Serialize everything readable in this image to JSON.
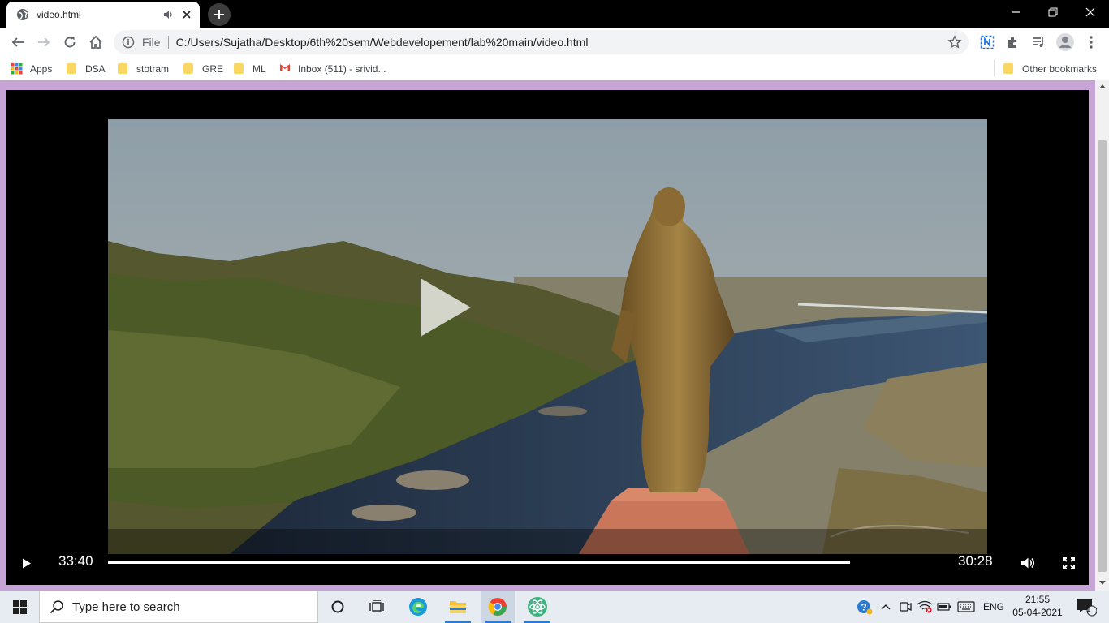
{
  "browser": {
    "tab": {
      "title": "video.html"
    },
    "address": {
      "scheme": "File",
      "url": "C:/Users/Sujatha/Desktop/6th%20sem/Webdevelopement/lab%20main/video.html"
    },
    "bookmarks": [
      {
        "label": "Apps",
        "icon": "apps-grid-icon"
      },
      {
        "label": "DSA",
        "icon": "folder-icon"
      },
      {
        "label": "stotram",
        "icon": "folder-icon"
      },
      {
        "label": "GRE",
        "icon": "folder-icon"
      },
      {
        "label": "ML",
        "icon": "folder-icon"
      },
      {
        "label": "Inbox (511) - srivid...",
        "icon": "gmail-icon"
      }
    ],
    "other_bookmarks": "Other bookmarks"
  },
  "video": {
    "current_time": "33:40",
    "remaining_time": "30:28"
  },
  "taskbar": {
    "search_placeholder": "Type here to search",
    "language": "ENG",
    "time": "21:55",
    "date": "05-04-2021",
    "notification_count": "1"
  },
  "colors": {
    "page_background": "#c6a5d6",
    "player_background": "#000000",
    "accent": "#2a7bd4"
  }
}
